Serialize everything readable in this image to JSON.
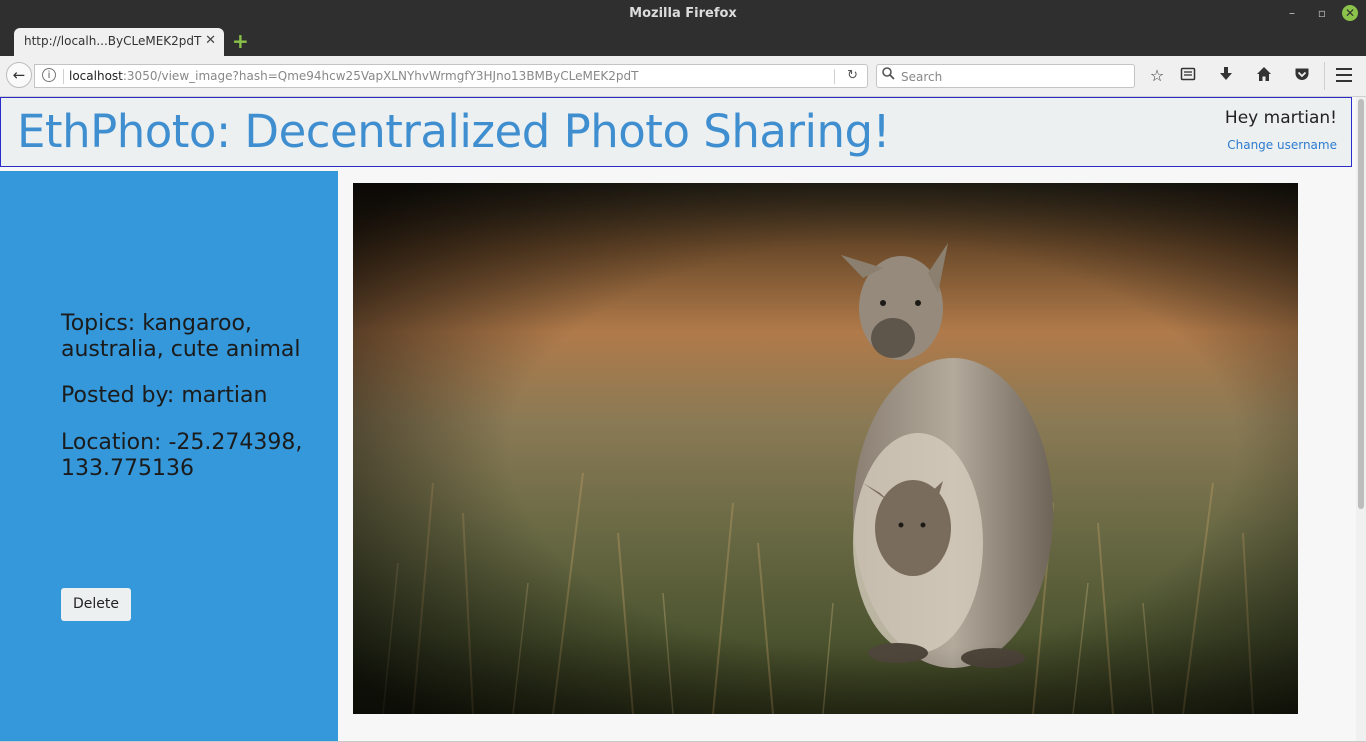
{
  "window": {
    "title": "Mozilla Firefox",
    "minimize": "–",
    "maximize": "▫",
    "close": "✕"
  },
  "tab": {
    "title": "http://localh...ByCLeMEK2pdT",
    "close": "✕",
    "new_tab": "+"
  },
  "navbar": {
    "url_host": "localhost",
    "url_rest": ":3050/view_image?hash=Qme94hcw25VapXLNYhvWrmgfY3HJno13BMByCLeMEK2pdT",
    "search_placeholder": "Search",
    "icons": [
      "back-icon",
      "info-icon",
      "reload-icon",
      "search-icon",
      "bookmark-star-icon",
      "reading-list-icon",
      "download-icon",
      "home-icon",
      "pocket-icon",
      "menu-icon"
    ]
  },
  "header": {
    "title": "EthPhoto: Decentralized Photo Sharing!",
    "greeting": "Hey martian!",
    "change_username": "Change username"
  },
  "sidebar": {
    "topics": "Topics: kangaroo, australia, cute animal",
    "posted_by": "Posted by: martian",
    "location": "Location: -25.274398, 133.775136",
    "delete_label": "Delete"
  },
  "colors": {
    "sidebar": "#3498db",
    "title": "#3f8ed0",
    "header_bg": "#ecf0f1",
    "header_border": "#2b2bcc",
    "chrome": "#2f2f2f"
  }
}
